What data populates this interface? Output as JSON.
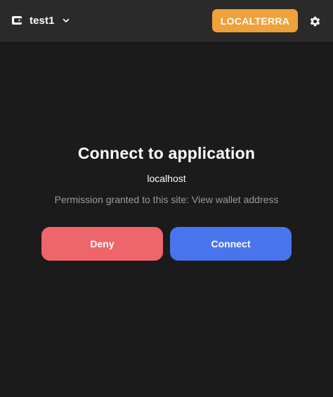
{
  "header": {
    "wallet": {
      "name": "test1",
      "icon": "wallet-icon",
      "dropdown_icon": "chevron-down-icon"
    },
    "network": {
      "label": "LOCALTERRA",
      "color": "#f1a13c"
    },
    "settings_icon": "gear-icon"
  },
  "connect": {
    "title": "Connect to application",
    "origin": "localhost",
    "permission": "Permission granted to this site: View wallet address"
  },
  "actions": {
    "deny_label": "Deny",
    "deny_color": "#ef656c",
    "connect_label": "Connect",
    "connect_color": "#4a74ee"
  },
  "colors": {
    "background": "#1b1b1c",
    "header_background": "#2a2a2b",
    "muted_text": "#9a9a9d"
  }
}
